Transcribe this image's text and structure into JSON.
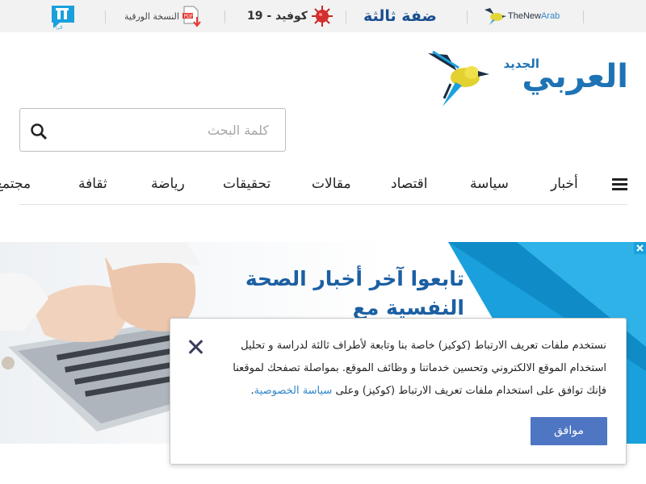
{
  "topbar": {
    "thenewarab": {
      "pre": "TheNew",
      "accent": "Arab"
    },
    "third_side": "ضفة ثالثة",
    "covid": "كوفيد - 19",
    "paper_edition": "النسخة الورقية",
    "paper_icon_text": "PDF",
    "alaraby_tv": "ألترا"
  },
  "logo": {
    "main": "العربي",
    "small": "الجديد"
  },
  "search": {
    "placeholder": "كلمة البحث"
  },
  "nav": {
    "items": [
      "أخبار",
      "سياسة",
      "اقتصاد",
      "مقالات",
      "تحقيقات",
      "رياضة",
      "ثقافة",
      "مجتمع"
    ]
  },
  "banner": {
    "title": "تابعوا آخر أخبار الصحة النفسية مع"
  },
  "cookie": {
    "line1": "نستخدم ملفات تعريف الارتباط (كوكيز) خاصة بنا وتابعة لأطراف ثالثة لدراسة و تحليل",
    "line2": "استخدام الموقع الالكتروني وتحسين خدماتنا و وظائف الموقع. بمواصلة تصفحك لموقعنا",
    "line3": "فإنك توافق على استخدام ملفات تعريف الارتباط (كوكيز) وعلى",
    "link": "سياسة الخصوصية",
    "tail": ".",
    "agree": "موافق"
  },
  "colors": {
    "accent_blue": "#1e73b5",
    "button_blue": "#4e76c3",
    "banner_blue": "#1aa0dc",
    "banner_title": "#1c5fa3"
  }
}
